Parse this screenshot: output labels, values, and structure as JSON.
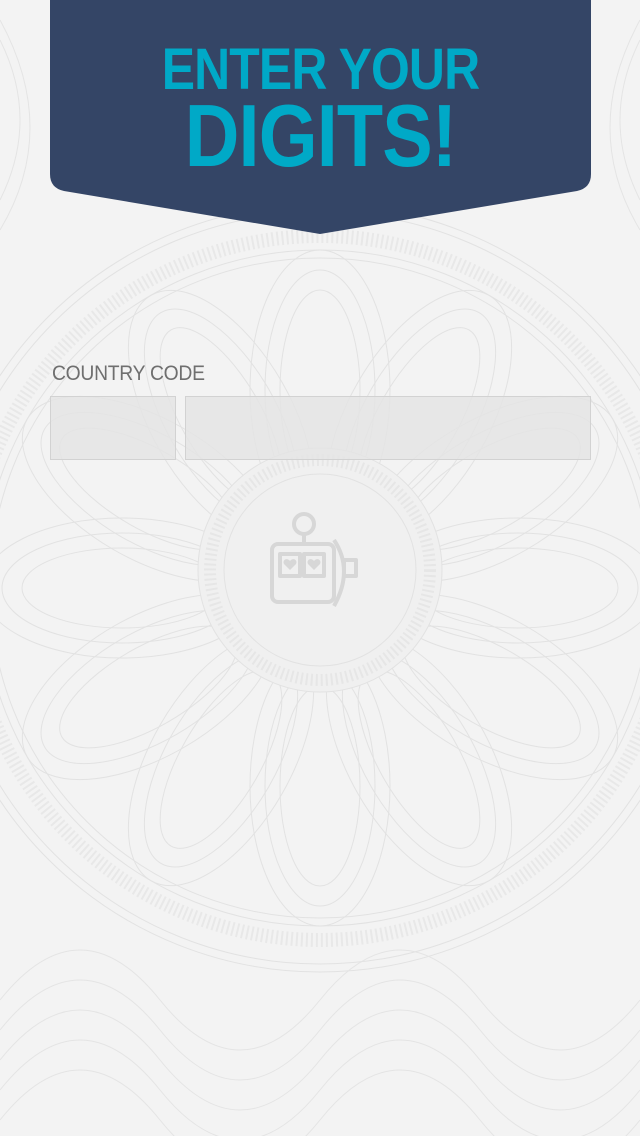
{
  "banner": {
    "line1": "ENTER YOUR",
    "line2": "DIGITS!"
  },
  "form": {
    "country_code_label": "COUNTRY CODE",
    "country_code_value": "",
    "phone_value": ""
  },
  "colors": {
    "banner_bg": "#344566",
    "banner_text": "#00a9c7",
    "background": "#f3f3f3",
    "label": "#6f6f6f"
  },
  "icons": {
    "emblem": "slot-machine-icon"
  }
}
